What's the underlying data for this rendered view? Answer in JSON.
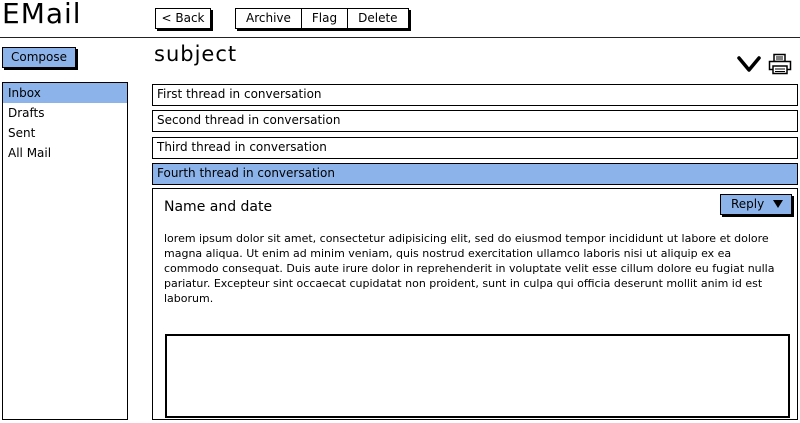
{
  "app": {
    "title": "EMail"
  },
  "toolbar": {
    "back_label": "< Back",
    "archive_label": "Archive",
    "flag_label": "Flag",
    "delete_label": "Delete"
  },
  "sidebar": {
    "compose_label": "Compose",
    "items": [
      {
        "label": "Inbox",
        "active": true
      },
      {
        "label": "Drafts",
        "active": false
      },
      {
        "label": "Sent",
        "active": false
      },
      {
        "label": "All Mail",
        "active": false
      }
    ]
  },
  "conversation": {
    "subject": "subject",
    "threads": [
      {
        "label": "First thread in conversation"
      },
      {
        "label": "Second thread in conversation"
      },
      {
        "label": "Third thread in conversation"
      },
      {
        "label": "Fourth thread in conversation"
      }
    ],
    "selected_thread": 3,
    "message": {
      "from": "Name and date",
      "reply_label": "Reply",
      "body": "lorem ipsum dolor sit amet, consectetur adipisicing elit, sed do eiusmod tempor incididunt ut labore et dolore magna aliqua. Ut enim ad minim veniam, quis nostrud exercitation ullamco laboris nisi ut aliquip ex ea commodo consequat. Duis aute irure dolor in reprehenderit in voluptate velit esse cillum dolore eu fugiat nulla pariatur. Excepteur sint occaecat cupidatat non proident, sunt in culpa qui officia deserunt mollit anim id est laborum.",
      "reply_text": ""
    }
  },
  "icons": {
    "expand": "chevron-down-icon",
    "print": "printer-icon"
  },
  "colors": {
    "selected": "#8cb4ea",
    "border": "#000000"
  }
}
